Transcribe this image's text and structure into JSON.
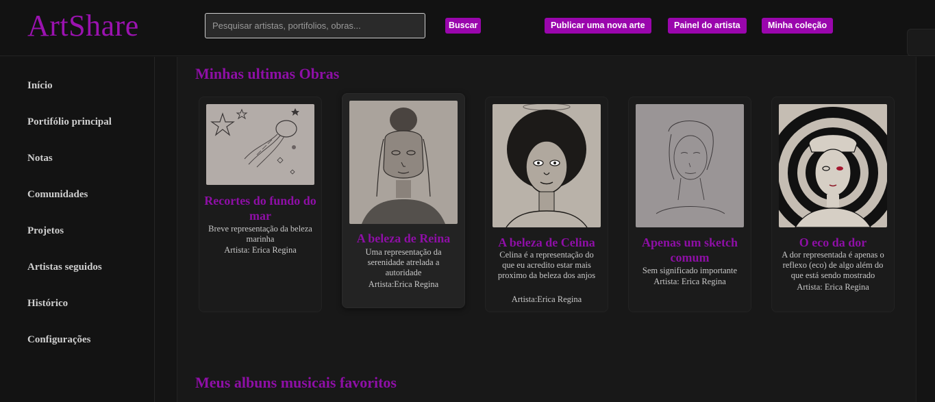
{
  "header": {
    "logo": "ArtShare",
    "search_placeholder": "Pesquisar artistas, portifolios, obras...",
    "search_button": "Buscar",
    "publish_button": "Publicar uma nova arte",
    "panel_button": "Painel do artista",
    "collection_button": "Minha coleção"
  },
  "sidebar": {
    "items": [
      {
        "label": "Início"
      },
      {
        "label": "Portifólio principal"
      },
      {
        "label": "Notas"
      },
      {
        "label": "Comunidades"
      },
      {
        "label": "Projetos"
      },
      {
        "label": "Artistas seguidos"
      },
      {
        "label": "Histórico"
      },
      {
        "label": "Configurações"
      }
    ]
  },
  "main": {
    "recent_title": "Minhas ultimas Obras",
    "albums_title": "Meus albuns musicais favoritos",
    "artworks": [
      {
        "title": "Recortes do fundo do mar",
        "description": "Breve representação da beleza marinha",
        "artist": "Artista: Erica Regina"
      },
      {
        "title": "A beleza de Reina",
        "description": "Uma representação da serenidade atrelada a autoridade",
        "artist": "Artista:Erica Regina"
      },
      {
        "title": "A beleza de Celina",
        "description": "Celina é a representação do que eu acredito estar mais proximo da beleza dos anjos",
        "artist": "Artista:Erica Regina"
      },
      {
        "title": "Apenas um sketch comum",
        "description": "Sem significado importante",
        "artist": "Artista: Erica Regina"
      },
      {
        "title": "O eco da dor",
        "description": "A dor representada é apenas o reflexo (eco) de algo além do que está sendo mostrado",
        "artist": "Artista: Erica Regina"
      }
    ]
  },
  "colors": {
    "accent": "#9a06ad",
    "background": "#141414"
  }
}
